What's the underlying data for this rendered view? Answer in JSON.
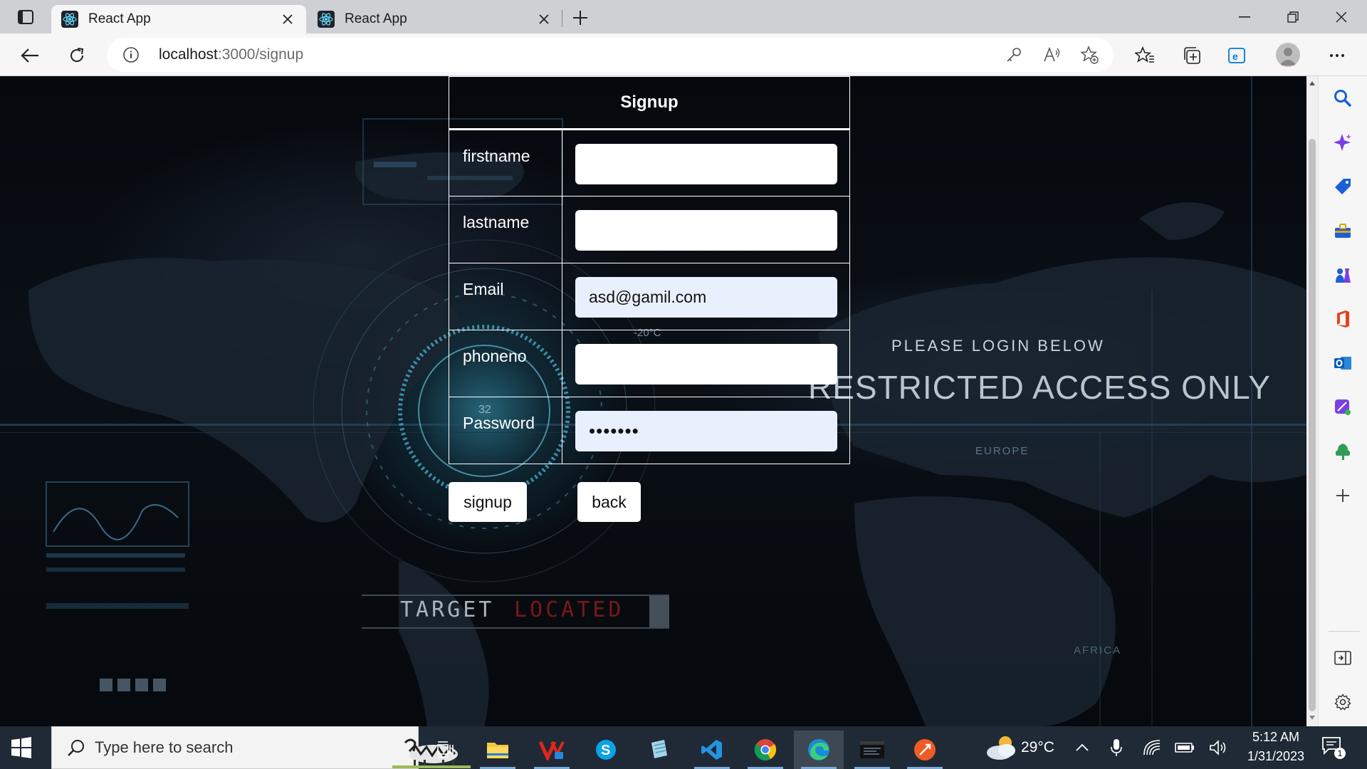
{
  "browser": {
    "tabs": [
      {
        "title": "React App",
        "active": true
      },
      {
        "title": "React App",
        "active": false
      }
    ],
    "url_host": "localhost",
    "url_rest": ":3000/signup"
  },
  "page": {
    "background_text": {
      "please_login": "PLEASE LOGIN BELOW",
      "restricted": "RESTRICTED ACCESS ONLY",
      "europe": "EUROPE",
      "africa": "AFRICA",
      "target": "TARGET",
      "located": "LOCATED",
      "temperature": "-20°C",
      "ring_number": "32"
    },
    "form": {
      "heading": "Signup",
      "fields": [
        {
          "label": "firstname",
          "value": ""
        },
        {
          "label": "lastname",
          "value": ""
        },
        {
          "label": "Email",
          "value": "asd@gamil.com"
        },
        {
          "label": "phoneno",
          "value": ""
        },
        {
          "label": "Password",
          "value": "•••••••"
        }
      ],
      "signup_button": "signup",
      "back_button": "back"
    }
  },
  "taskbar": {
    "search_placeholder": "Type here to search",
    "weather_temp": "29°C",
    "time": "5:12 AM",
    "date": "1/31/2023",
    "notification_count": "1"
  },
  "colors": {
    "accent": "#0078d4",
    "taskbar": "#1f2a36",
    "autofill": "#e9f0fd"
  }
}
